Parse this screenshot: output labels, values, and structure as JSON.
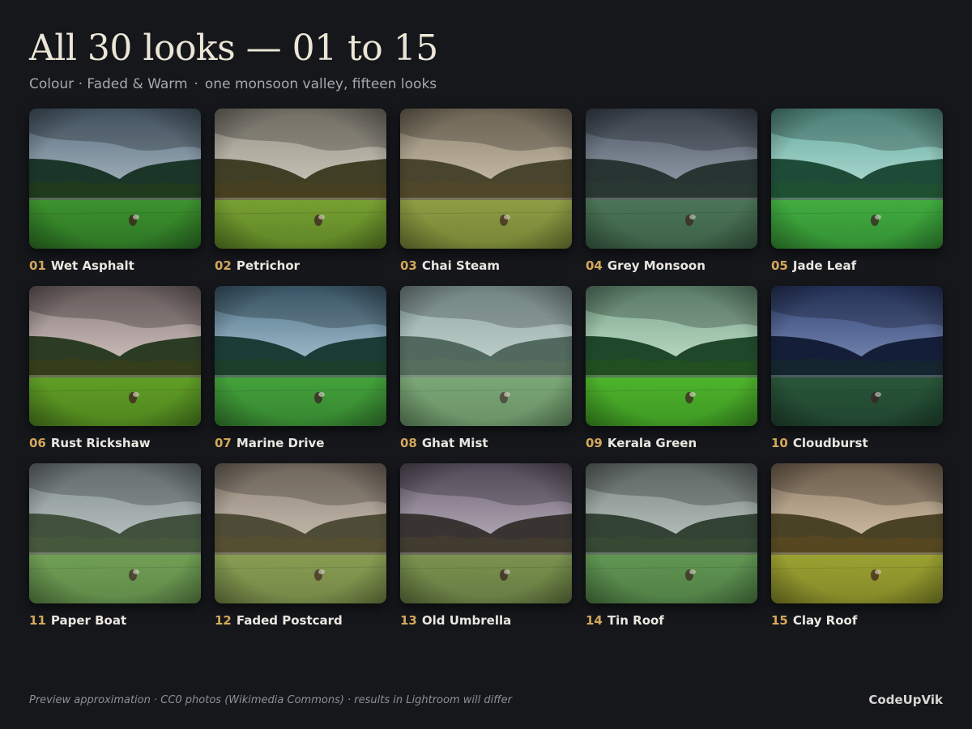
{
  "header": {
    "title": "All 30 looks — 01 to 15",
    "subtitle_category": "Colour · Faded & Warm",
    "subtitle_separator": "·",
    "subtitle_tagline": "one monsoon valley, fifteen looks"
  },
  "looks": [
    {
      "num": "01",
      "name": "Wet Asphalt",
      "palette": {
        "sky_top": "#5f7385",
        "sky_bottom": "#b5c3cc",
        "hills": "#1c3526",
        "trees": "#1f3a1a",
        "field": "#3f9a2c",
        "field_low": "#2f7a22",
        "tint": "#2b3d4a",
        "tint_opacity": 0.08
      }
    },
    {
      "num": "02",
      "name": "Petrichor",
      "palette": {
        "sky_top": "#9c9a90",
        "sky_bottom": "#d7d5cb",
        "hills": "#3b3d24",
        "trees": "#433e1e",
        "field": "#78a831",
        "field_low": "#5d8a24",
        "tint": "#6d5a3a",
        "tint_opacity": 0.1
      }
    },
    {
      "num": "03",
      "name": "Chai Steam",
      "palette": {
        "sky_top": "#8f8676",
        "sky_bottom": "#d8cfbd",
        "hills": "#3e3d29",
        "trees": "#474126",
        "field": "#8fa444",
        "field_low": "#748834",
        "tint": "#8a6f44",
        "tint_opacity": 0.14
      }
    },
    {
      "num": "04",
      "name": "Grey Monsoon",
      "palette": {
        "sky_top": "#4f5866",
        "sky_bottom": "#a9b2bd",
        "hills": "#25322c",
        "trees": "#27362d",
        "field": "#4f7d57",
        "field_low": "#3e6647",
        "tint": "#3a4652",
        "tint_opacity": 0.14
      }
    },
    {
      "num": "05",
      "name": "Jade Leaf",
      "palette": {
        "sky_top": "#6eb0a4",
        "sky_bottom": "#c4e6df",
        "hills": "#1d4432",
        "trees": "#1d4a2a",
        "field": "#44b03a",
        "field_low": "#36922d",
        "tint": "#2a8a74",
        "tint_opacity": 0.1
      }
    },
    {
      "num": "06",
      "name": "Rust Rickshaw",
      "palette": {
        "sky_top": "#8a7f80",
        "sky_bottom": "#ddd2cf",
        "hills": "#253a22",
        "trees": "#2e3d17",
        "field": "#5ea624",
        "field_low": "#4b8a1c",
        "tint": "#7a4a3a",
        "tint_opacity": 0.08
      }
    },
    {
      "num": "07",
      "name": "Marine Drive",
      "palette": {
        "sky_top": "#51758a",
        "sky_bottom": "#b8d0dc",
        "hills": "#1a3a32",
        "trees": "#1b3d24",
        "field": "#46a836",
        "field_low": "#38892b",
        "tint": "#2c5a74",
        "tint_opacity": 0.08
      }
    },
    {
      "num": "08",
      "name": "Ghat Mist",
      "palette": {
        "sky_top": "#8ea6a2",
        "sky_bottom": "#cfdcd8",
        "hills": "#41594f",
        "trees": "#47604b",
        "field": "#73a56a",
        "field_low": "#5f8b58",
        "tint": "#9bb3ad",
        "tint_opacity": 0.18
      }
    },
    {
      "num": "09",
      "name": "Kerala Green",
      "palette": {
        "sky_top": "#7ea890",
        "sky_bottom": "#cfe7d6",
        "hills": "#1d4228",
        "trees": "#1f4a1d",
        "field": "#4fb72a",
        "field_low": "#3f9a20",
        "tint": "#3c8a4a",
        "tint_opacity": 0.08
      }
    },
    {
      "num": "10",
      "name": "Cloudburst",
      "palette": {
        "sky_top": "#35477a",
        "sky_bottom": "#8ea0c6",
        "hills": "#141d33",
        "trees": "#142528",
        "field": "#2b5e34",
        "field_low": "#214a29",
        "tint": "#1d2a5a",
        "tint_opacity": 0.14
      }
    },
    {
      "num": "11",
      "name": "Paper Boat",
      "palette": {
        "sky_top": "#7f8a8c",
        "sky_bottom": "#c6ced0",
        "hills": "#35452f",
        "trees": "#3b4d2e",
        "field": "#6ba04a",
        "field_low": "#58873d",
        "tint": "#8f9a94",
        "tint_opacity": 0.14
      }
    },
    {
      "num": "12",
      "name": "Faded Postcard",
      "palette": {
        "sky_top": "#8d8378",
        "sky_bottom": "#d3cac0",
        "hills": "#40412c",
        "trees": "#484427",
        "field": "#84a14d",
        "field_low": "#6d873f",
        "tint": "#9a8a70",
        "tint_opacity": 0.16
      }
    },
    {
      "num": "13",
      "name": "Old Umbrella",
      "palette": {
        "sky_top": "#6c6273",
        "sky_bottom": "#c9c0c9",
        "hills": "#332f2a",
        "trees": "#3c3826",
        "field": "#7d9a4a",
        "field_low": "#66803c",
        "tint": "#6e5a74",
        "tint_opacity": 0.12
      }
    },
    {
      "num": "14",
      "name": "Tin Roof",
      "palette": {
        "sky_top": "#7d8885",
        "sky_bottom": "#c9d2cf",
        "hills": "#2b3b2c",
        "trees": "#2e432b",
        "field": "#5f9a4e",
        "field_low": "#4d8040",
        "tint": "#6c7a72",
        "tint_opacity": 0.12
      }
    },
    {
      "num": "15",
      "name": "Clay Roof",
      "palette": {
        "sky_top": "#8c7d6d",
        "sky_bottom": "#e0d2bf",
        "hills": "#3c3a21",
        "trees": "#4a3f1c",
        "field": "#9aa82f",
        "field_low": "#7f8b25",
        "tint": "#a0763e",
        "tint_opacity": 0.14
      }
    }
  ],
  "footer": {
    "note": "Preview approximation · CC0 photos (Wikimedia Commons) · results in Lightroom will differ",
    "brand": "CodeUpVik"
  }
}
